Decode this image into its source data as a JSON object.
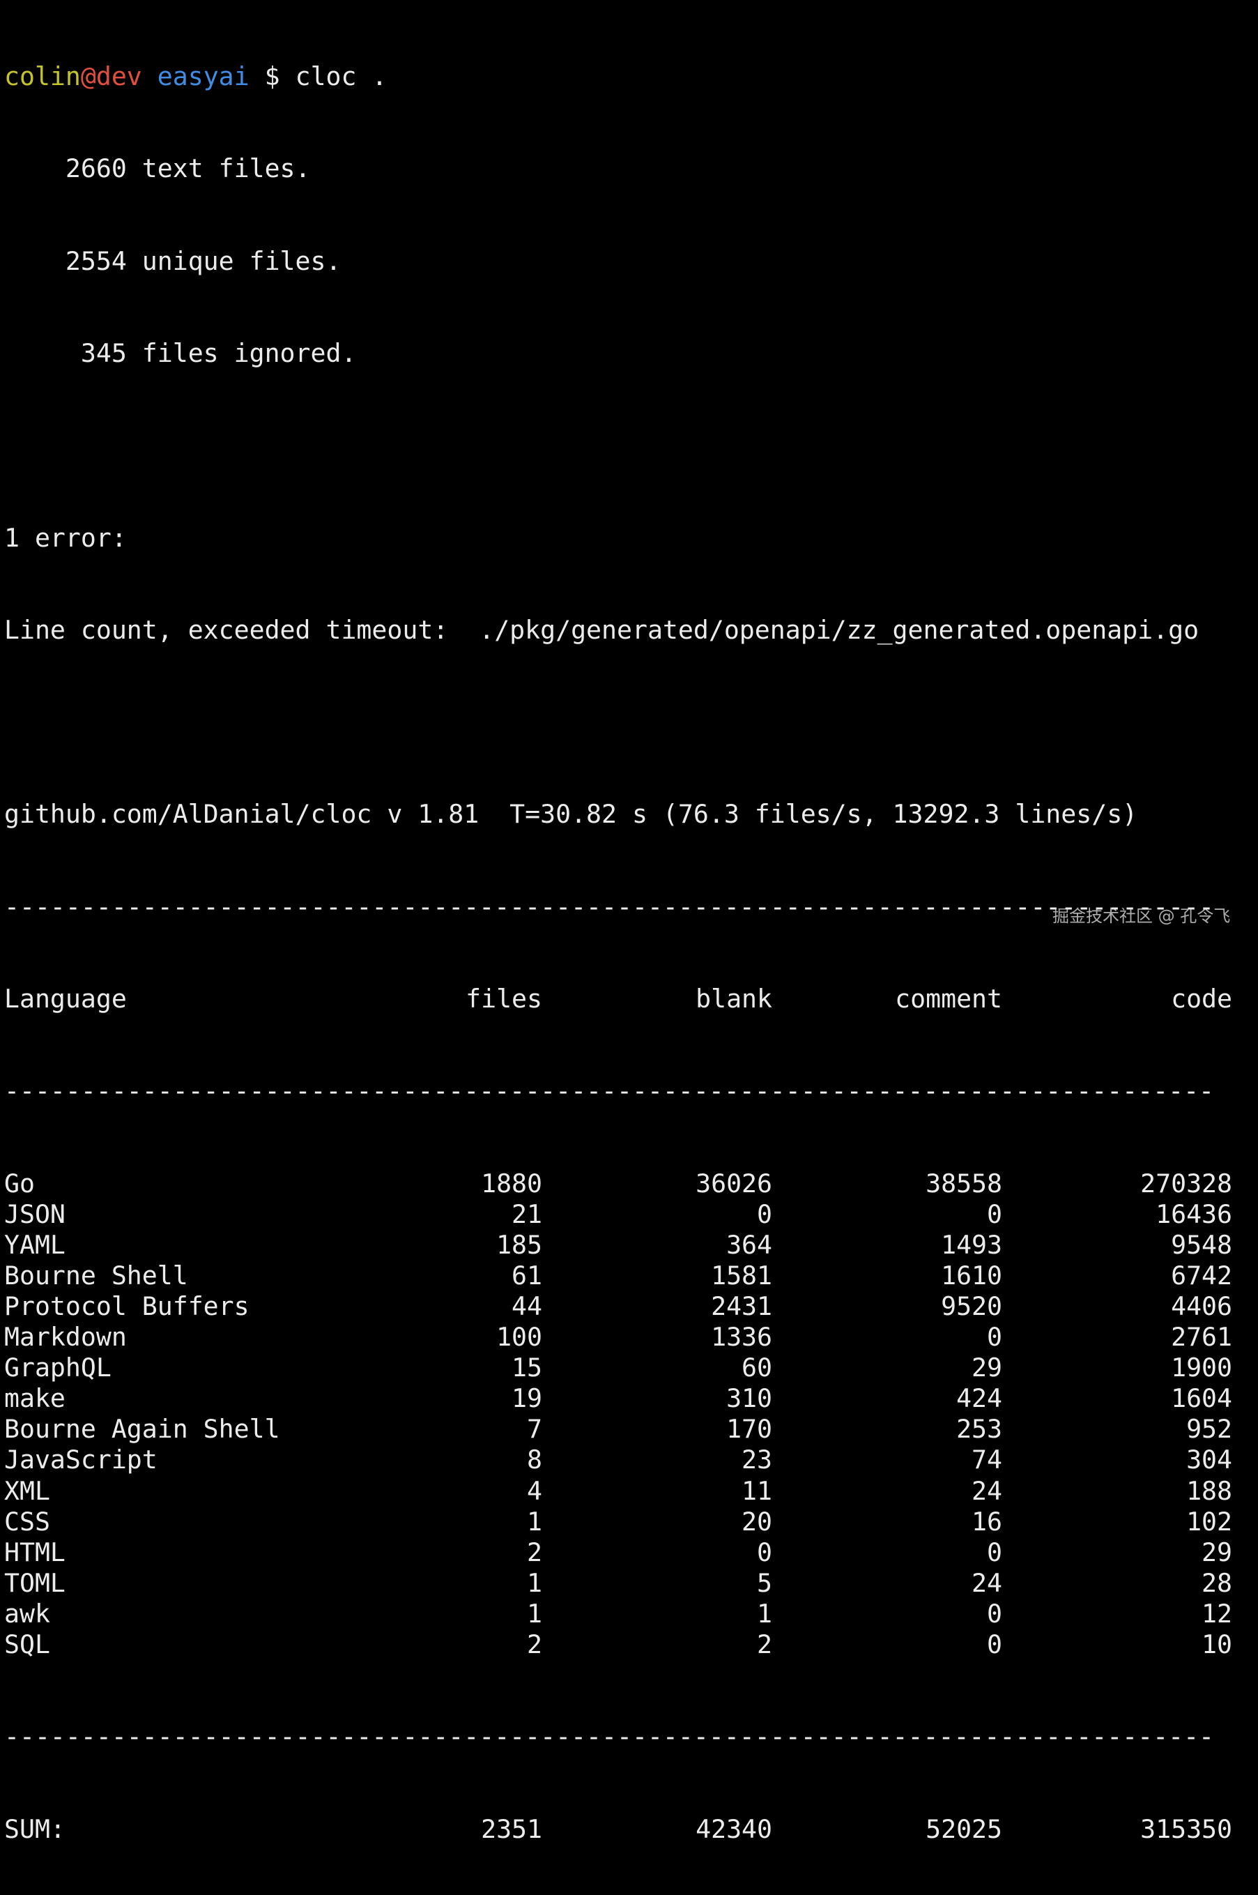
{
  "prompt": {
    "user": "colin",
    "at": "@",
    "host": "dev",
    "dir": "easyai",
    "symbol": "$",
    "command": "cloc ."
  },
  "summary_lines": [
    "    2660 text files.",
    "    2554 unique files.",
    "     345 files ignored."
  ],
  "error": {
    "header": "1 error:",
    "message": "Line count, exceeded timeout:  ./pkg/generated/openapi/zz_generated.openapi.go"
  },
  "version_line": "github.com/AlDanial/cloc v 1.81  T=30.82 s (76.3 files/s, 13292.3 lines/s)",
  "separator": "-------------------------------------------------------------------------------",
  "table": {
    "headers": {
      "language": "Language",
      "files": "files",
      "blank": "blank",
      "comment": "comment",
      "code": "code"
    },
    "rows": [
      {
        "language": "Go",
        "files": "1880",
        "blank": "36026",
        "comment": "38558",
        "code": "270328"
      },
      {
        "language": "JSON",
        "files": "21",
        "blank": "0",
        "comment": "0",
        "code": "16436"
      },
      {
        "language": "YAML",
        "files": "185",
        "blank": "364",
        "comment": "1493",
        "code": "9548"
      },
      {
        "language": "Bourne Shell",
        "files": "61",
        "blank": "1581",
        "comment": "1610",
        "code": "6742"
      },
      {
        "language": "Protocol Buffers",
        "files": "44",
        "blank": "2431",
        "comment": "9520",
        "code": "4406"
      },
      {
        "language": "Markdown",
        "files": "100",
        "blank": "1336",
        "comment": "0",
        "code": "2761"
      },
      {
        "language": "GraphQL",
        "files": "15",
        "blank": "60",
        "comment": "29",
        "code": "1900"
      },
      {
        "language": "make",
        "files": "19",
        "blank": "310",
        "comment": "424",
        "code": "1604"
      },
      {
        "language": "Bourne Again Shell",
        "files": "7",
        "blank": "170",
        "comment": "253",
        "code": "952"
      },
      {
        "language": "JavaScript",
        "files": "8",
        "blank": "23",
        "comment": "74",
        "code": "304"
      },
      {
        "language": "XML",
        "files": "4",
        "blank": "11",
        "comment": "24",
        "code": "188"
      },
      {
        "language": "CSS",
        "files": "1",
        "blank": "20",
        "comment": "16",
        "code": "102"
      },
      {
        "language": "HTML",
        "files": "2",
        "blank": "0",
        "comment": "0",
        "code": "29"
      },
      {
        "language": "TOML",
        "files": "1",
        "blank": "5",
        "comment": "24",
        "code": "28"
      },
      {
        "language": "awk",
        "files": "1",
        "blank": "1",
        "comment": "0",
        "code": "12"
      },
      {
        "language": "SQL",
        "files": "2",
        "blank": "2",
        "comment": "0",
        "code": "10"
      }
    ],
    "sum": {
      "language": "SUM:",
      "files": "2351",
      "blank": "42340",
      "comment": "52025",
      "code": "315350"
    }
  },
  "watermark": "掘金技术社区 @ 孔令飞",
  "colors": {
    "background": "#000000",
    "text": "#ececec",
    "user": "#c4c42a",
    "host": "#e0503c",
    "dir": "#3f8de4"
  }
}
